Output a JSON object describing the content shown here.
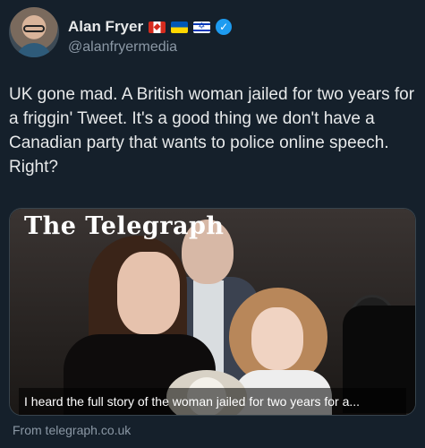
{
  "author": {
    "display_name": "Alan Fryer",
    "handle": "@alanfryermedia",
    "badges": [
      "canada-flag-icon",
      "ukraine-flag-icon",
      "israel-flag-icon",
      "verified-badge-icon"
    ]
  },
  "tweet": {
    "text": "UK gone mad. A British woman jailed for two years for a friggin' Tweet.  It's a good thing we don't have a Canadian party that wants to police online speech. Right?"
  },
  "card": {
    "logo_text": "The Telegraph",
    "caption": "I heard the full story of the woman jailed for two years for a...",
    "source": "From telegraph.co.uk"
  },
  "colors": {
    "background": "#15202b",
    "verified": "#1d9bf0",
    "secondary_text": "#8b98a5"
  }
}
